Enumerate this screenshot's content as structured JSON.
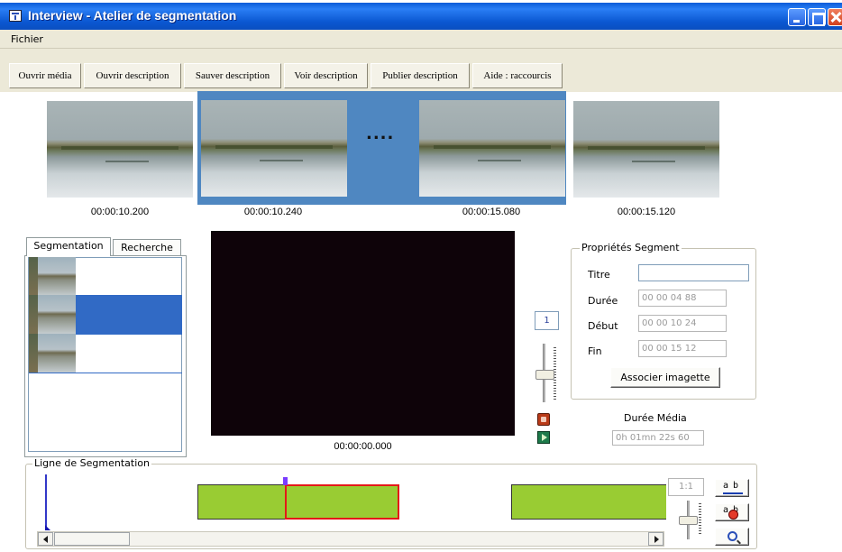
{
  "window": {
    "title": "Interview - Atelier de segmentation"
  },
  "menu": {
    "items": [
      "Fichier"
    ]
  },
  "toolbar": {
    "buttons": [
      "Ouvrir média",
      "Ouvrir description",
      "Sauver description",
      "Voir description",
      "Publier description",
      "Aide : raccourcis"
    ]
  },
  "thumbnails": {
    "ellipsis": "....",
    "times": [
      "00:00:10.200",
      "00:00:10.240",
      "00:00:15.080",
      "00:00:15.120"
    ]
  },
  "tabs": [
    "Segmentation",
    "Recherche"
  ],
  "video": {
    "time": "00:00:00.000"
  },
  "zoom": {
    "value": "1"
  },
  "properties": {
    "legend": "Propriétés Segment",
    "titre_label": "Titre",
    "titre_value": "",
    "duree_label": "Durée",
    "duree_value": "00 00 04 88",
    "debut_label": "Début",
    "debut_value": "00 00 10 24",
    "fin_label": "Fin",
    "fin_value": "00 00 15 12",
    "associate_button": "Associer imagette"
  },
  "media": {
    "duration_label": "Durée Média",
    "duration_value": "0h 01mn 22s 60"
  },
  "timeline": {
    "legend": "Ligne de Segmentation",
    "ratio": "1:1",
    "ab_label": "ab",
    "cut_label": "ab"
  },
  "colors": {
    "title_bar": "#0a5bd8",
    "highlight": "#4f87c1",
    "selection": "#316ac5",
    "segment": "#99cc33",
    "active_segment_border": "#e41818"
  }
}
